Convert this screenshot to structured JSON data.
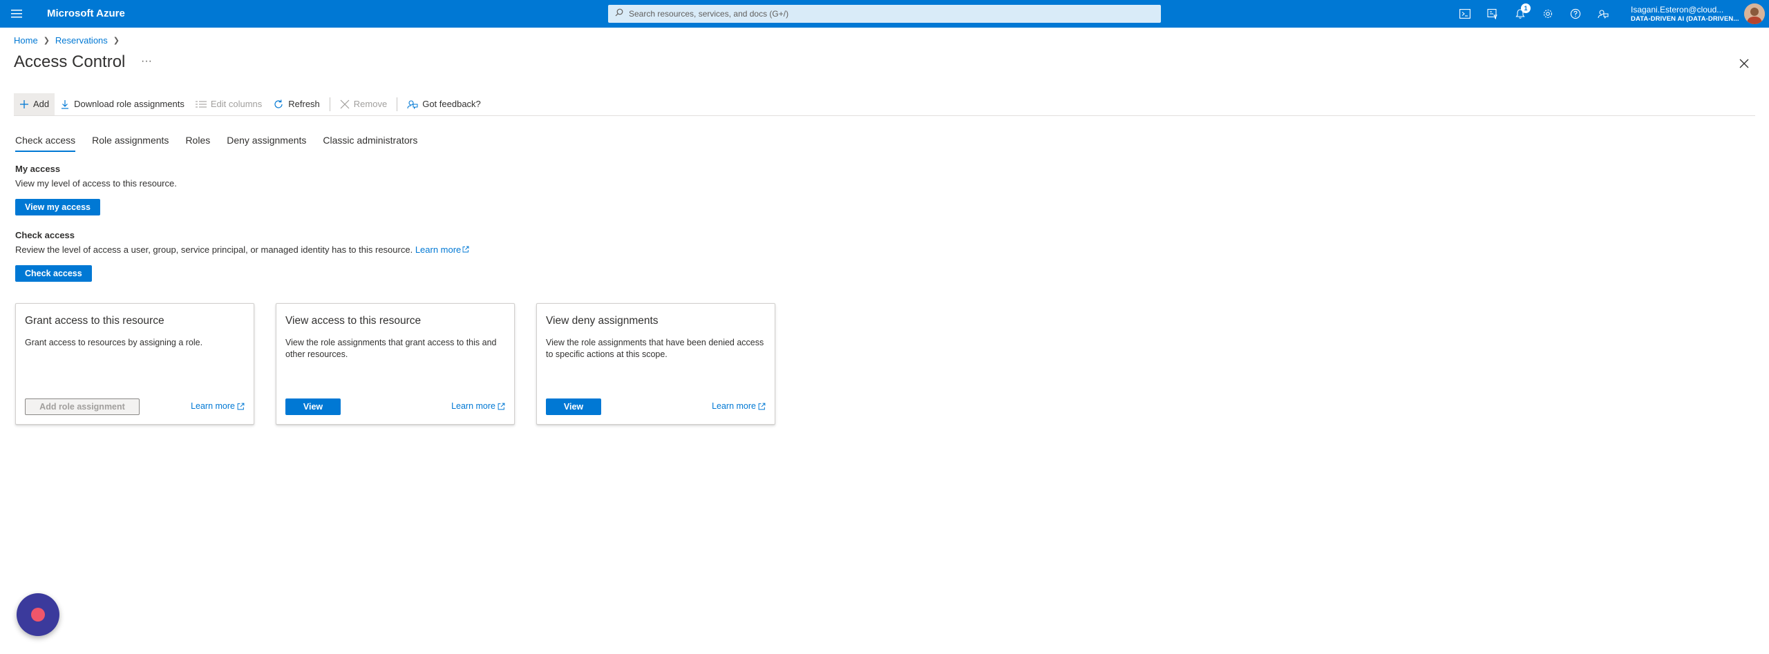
{
  "topbar": {
    "brand": "Microsoft Azure",
    "search_placeholder": "Search resources, services, and docs (G+/)",
    "notification_count": "1",
    "account_name": "Isagani.Esteron@cloud...",
    "account_tenant": "DATA-DRIVEN AI (DATA-DRIVEN...",
    "accent_color": "#0078d4"
  },
  "breadcrumb": {
    "items": [
      "Home",
      "Reservations"
    ]
  },
  "page": {
    "title": "Access Control",
    "more": "···"
  },
  "commands": {
    "add": "Add",
    "download": "Download role assignments",
    "edit_columns": "Edit columns",
    "refresh": "Refresh",
    "remove": "Remove",
    "feedback": "Got feedback?"
  },
  "tabs": [
    "Check access",
    "Role assignments",
    "Roles",
    "Deny assignments",
    "Classic administrators"
  ],
  "my_access": {
    "title": "My access",
    "description": "View my level of access to this resource.",
    "button": "View my access"
  },
  "check_access": {
    "title": "Check access",
    "description": "Review the level of access a user, group, service principal, or managed identity has to this resource.",
    "learn_more": "Learn more",
    "button": "Check access"
  },
  "cards": [
    {
      "title": "Grant access to this resource",
      "description": "Grant access to resources by assigning a role.",
      "button": "Add role assignment",
      "link": "Learn more"
    },
    {
      "title": "View access to this resource",
      "description": "View the role assignments that grant access to this and other resources.",
      "button": "View",
      "link": "Learn more"
    },
    {
      "title": "View deny assignments",
      "description": "View the role assignments that have been denied access to specific actions at this scope.",
      "button": "View",
      "link": "Learn more"
    }
  ]
}
